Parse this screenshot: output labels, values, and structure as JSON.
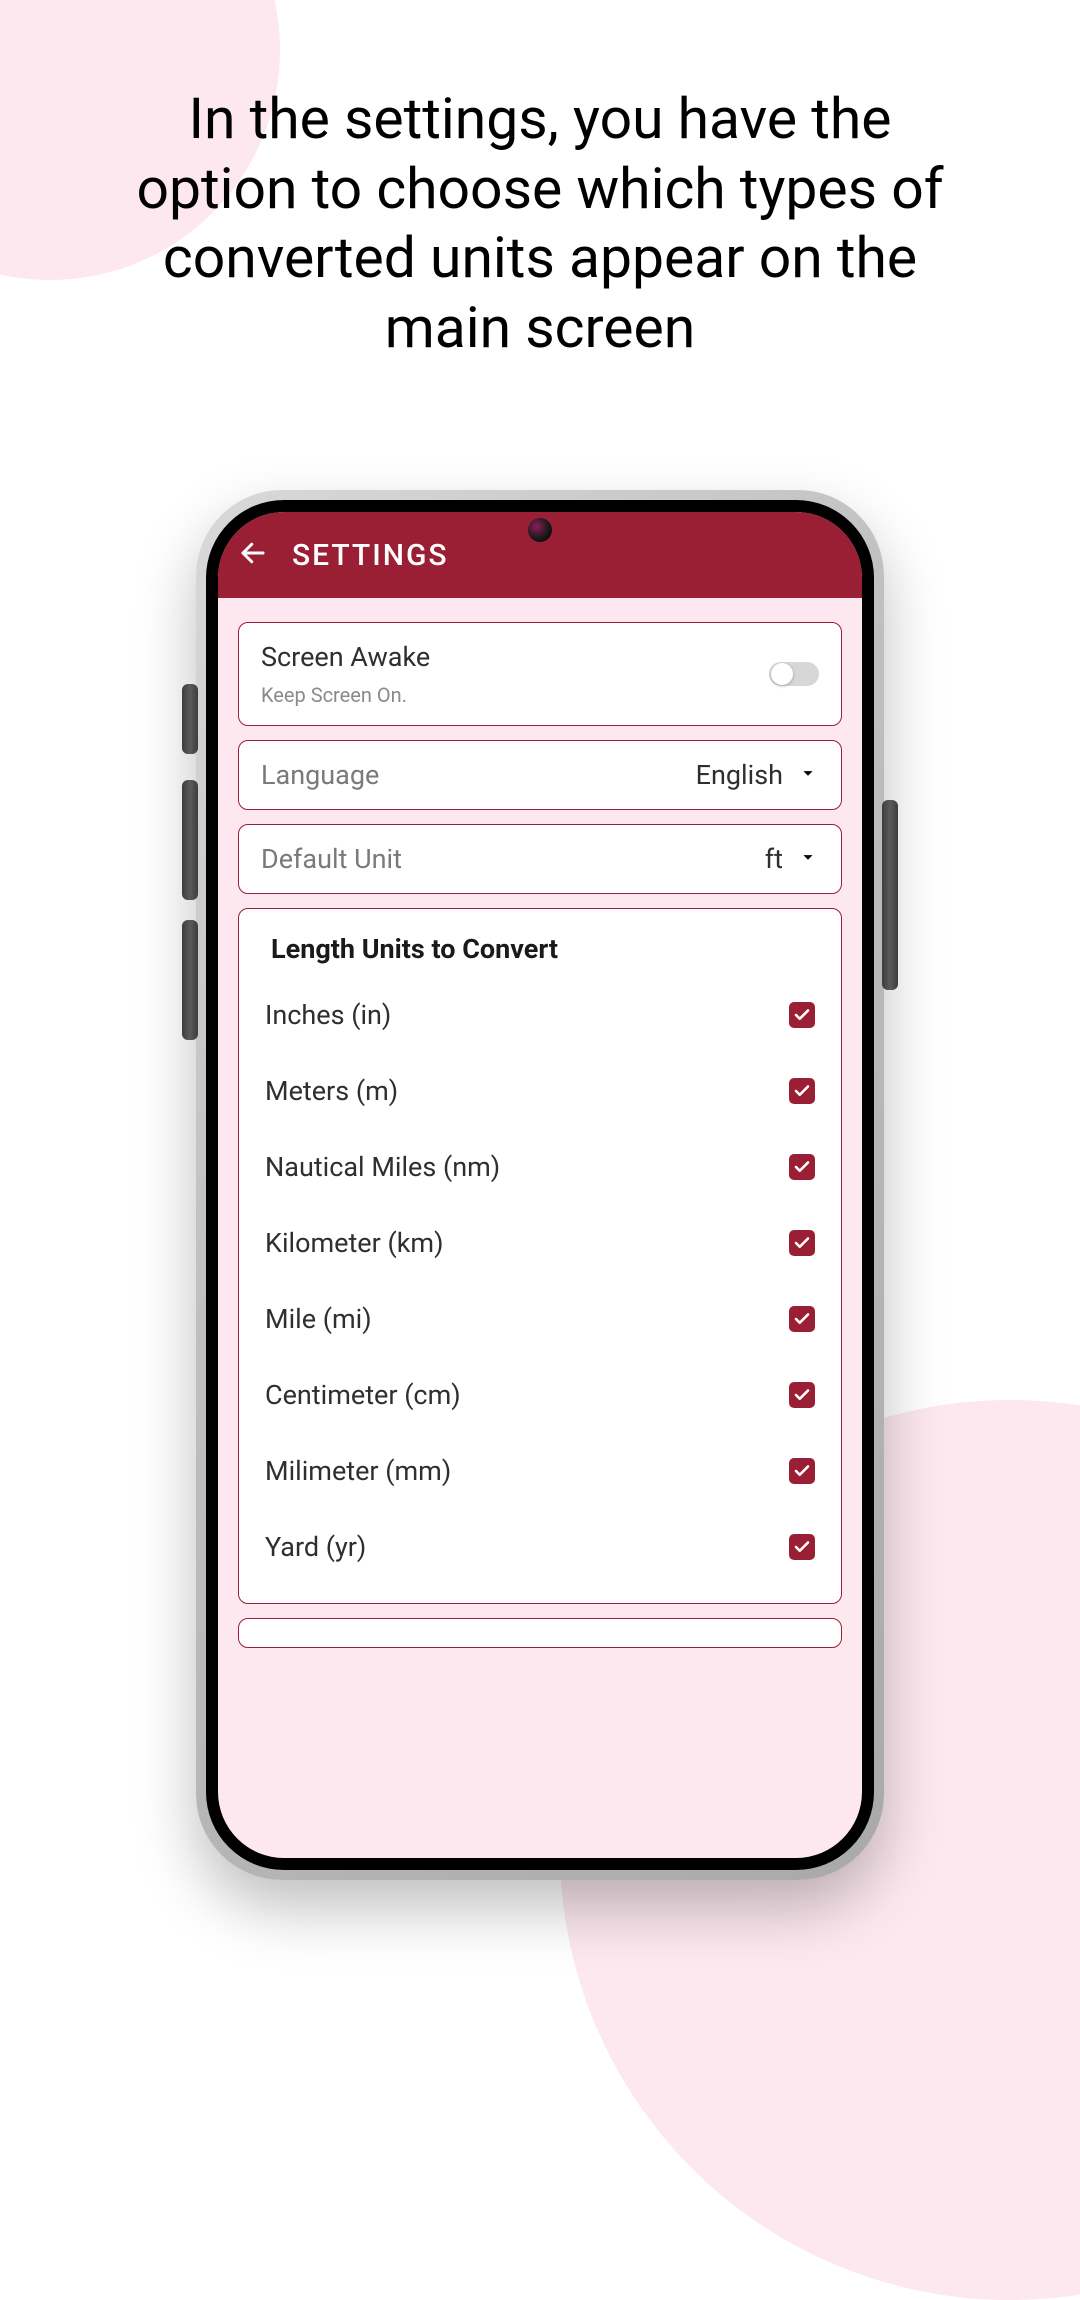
{
  "headline": "In the settings, you have the option to choose which types of converted units appear on the main screen",
  "appbar": {
    "title": "SETTINGS"
  },
  "settings": {
    "screenAwake": {
      "title": "Screen Awake",
      "subtitle": "Keep Screen On.",
      "enabled": false
    },
    "language": {
      "label": "Language",
      "value": "English"
    },
    "defaultUnit": {
      "label": "Default Unit",
      "value": "ft"
    }
  },
  "unitsSection": {
    "title": "Length Units to Convert",
    "items": [
      {
        "label": "Inches (in)",
        "checked": true
      },
      {
        "label": "Meters (m)",
        "checked": true
      },
      {
        "label": "Nautical Miles (nm)",
        "checked": true
      },
      {
        "label": "Kilometer (km)",
        "checked": true
      },
      {
        "label": "Mile (mi)",
        "checked": true
      },
      {
        "label": "Centimeter (cm)",
        "checked": true
      },
      {
        "label": "Milimeter (mm)",
        "checked": true
      },
      {
        "label": "Yard (yr)",
        "checked": true
      }
    ]
  }
}
